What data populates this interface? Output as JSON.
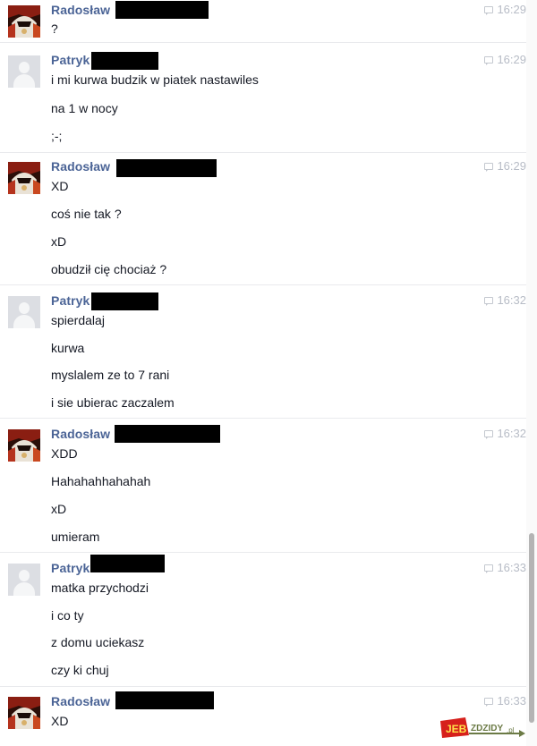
{
  "messages": [
    {
      "sender": "Radosław",
      "avatar": "profile-photo",
      "time": "16:29",
      "lines": [
        "?"
      ]
    },
    {
      "sender": "Patryk",
      "avatar": "default-silhouette",
      "time": "16:29",
      "lines": [
        "i mi kurwa budzik w piatek nastawiles",
        "na 1 w nocy",
        ";-;"
      ]
    },
    {
      "sender": "Radosław",
      "avatar": "profile-photo",
      "time": "16:29",
      "lines": [
        "XD",
        "coś nie tak ?",
        "xD",
        "obudził cię chociaż ?"
      ]
    },
    {
      "sender": "Patryk",
      "avatar": "default-silhouette",
      "time": "16:32",
      "lines": [
        "spierdalaj",
        "kurwa",
        "myslalem ze to 7 rani",
        "i sie ubierac zaczalem"
      ]
    },
    {
      "sender": "Radosław",
      "avatar": "profile-photo",
      "time": "16:32",
      "lines": [
        "XDD",
        "Hahahahhahahah",
        "xD",
        "umieram"
      ]
    },
    {
      "sender": "Patryk",
      "avatar": "default-silhouette",
      "time": "16:33",
      "lines": [
        "matka przychodzi",
        "i co ty",
        "z domu uciekasz",
        "czy ki chuj"
      ]
    },
    {
      "sender": "Radosław",
      "avatar": "profile-photo",
      "time": "16:33",
      "lines": [
        "XD"
      ]
    }
  ],
  "watermark": {
    "text": "JEBZDZIDY.pl"
  },
  "colors": {
    "sender": "#4b6496",
    "timestamp": "#b7bcc6",
    "text": "#141823",
    "separator": "#e9eaed",
    "redaction": "#000000"
  }
}
